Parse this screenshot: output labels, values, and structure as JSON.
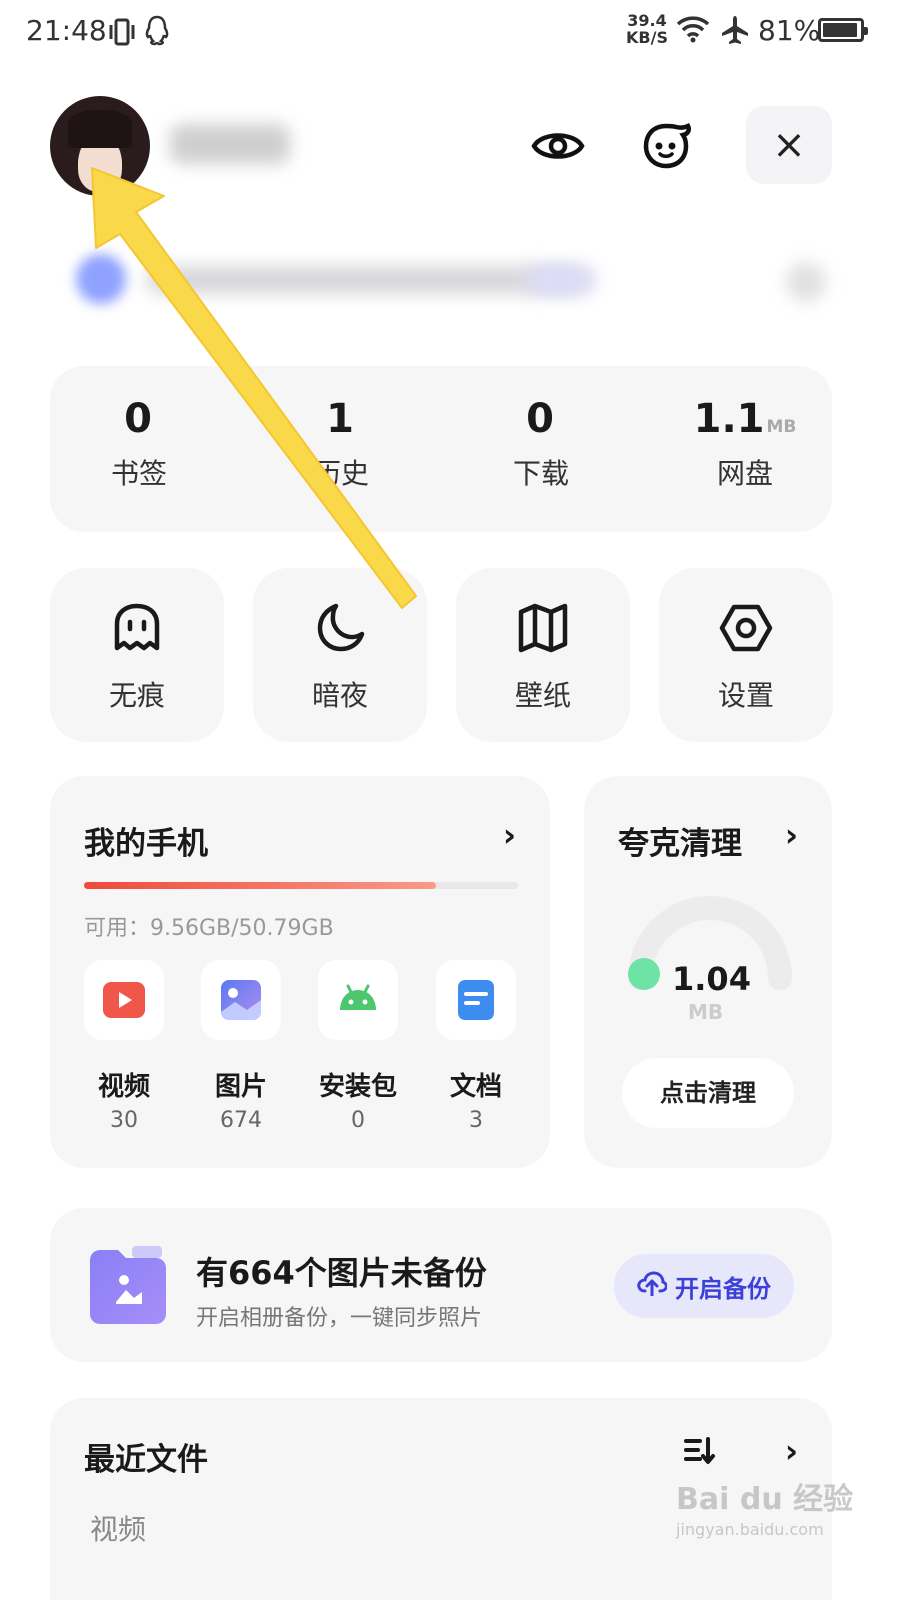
{
  "status_bar": {
    "time": "21:48",
    "speed_value": "39.4",
    "speed_unit": "KB/S",
    "battery": "81%",
    "icons": [
      "vibrate-icon",
      "qq-icon",
      "wifi-icon",
      "airplane-icon",
      "battery-icon"
    ]
  },
  "header": {
    "icons": [
      "avatar",
      "eye-icon",
      "mascot-icon",
      "close-icon"
    ],
    "close_label": "×"
  },
  "stats": [
    {
      "value": "0",
      "unit": "",
      "label": "书签"
    },
    {
      "value": "1",
      "unit": "",
      "label": "历史"
    },
    {
      "value": "0",
      "unit": "",
      "label": "下载"
    },
    {
      "value": "1.1",
      "unit": "MB",
      "label": "网盘"
    }
  ],
  "quick_tiles": [
    {
      "label": "无痕",
      "icon": "ghost-icon"
    },
    {
      "label": "暗夜",
      "icon": "moon-icon"
    },
    {
      "label": "壁纸",
      "icon": "wallpaper-icon"
    },
    {
      "label": "设置",
      "icon": "settings-icon"
    }
  ],
  "my_phone": {
    "title": "我的手机",
    "chevron": "›",
    "storage_used_fraction": 0.81,
    "available_text": "可用：9.56GB/50.79GB",
    "categories": [
      {
        "name": "视频",
        "count": "30",
        "icon": "video-icon",
        "color": "#f0574a"
      },
      {
        "name": "图片",
        "count": "674",
        "icon": "image-icon",
        "color": "#7f86f0"
      },
      {
        "name": "安装包",
        "count": "0",
        "icon": "android-icon",
        "color": "#4cc76d"
      },
      {
        "name": "文档",
        "count": "3",
        "icon": "document-icon",
        "color": "#3d8df0"
      }
    ]
  },
  "cleaner": {
    "title": "夸克清理",
    "chevron": "›",
    "value": "1.04",
    "unit": "MB",
    "button": "点击清理",
    "accent": "#6ee3a6"
  },
  "backup": {
    "title": "有664个图片未备份",
    "subtitle": "开启相册备份，一键同步照片",
    "button": "开启备份",
    "accent": "#3c3fd8"
  },
  "recent": {
    "title": "最近文件",
    "chevron": "›",
    "tab": "视频"
  },
  "watermark": {
    "brand": "Bai du 经验",
    "url": "jingyan.baidu.com"
  }
}
